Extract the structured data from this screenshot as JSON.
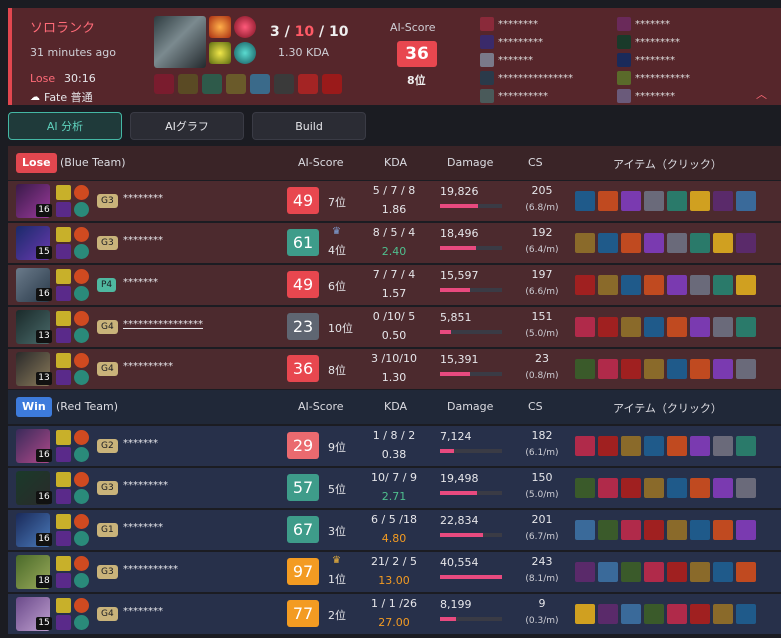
{
  "summary": {
    "queue": "ソロランク",
    "time_ago": "31 minutes ago",
    "result": "Lose",
    "duration": "30:16",
    "mode": "Fate 普通",
    "kda_kills": "3",
    "kda_deaths": "10",
    "kda_assists": "10",
    "kda_ratio": "1.30 KDA",
    "ai_score_label": "AI-Score",
    "ai_score": "36",
    "rank": "8位",
    "team_a": [
      "********",
      "*********",
      "*******",
      "***************",
      "**********"
    ],
    "team_b": [
      "*******",
      "*********",
      "********",
      "***********",
      "********"
    ]
  },
  "tabs": [
    "AI 分析",
    "AIグラフ",
    "Build"
  ],
  "headers": {
    "ai_score": "AI-Score",
    "kda": "KDA",
    "damage": "Damage",
    "cs": "CS",
    "items": "アイテム（クリック）"
  },
  "lose_team": {
    "badge": "Lose",
    "name": "(Blue Team)",
    "rows": [
      {
        "level": "16",
        "tier": "G3",
        "name": "********",
        "score": "49",
        "rank": "7位",
        "kda": "5 / 7 / 8",
        "ratio": "1.86",
        "damage": "19,826",
        "dmg_pct": 0.62,
        "cs": "205",
        "cspm": "(6.8/m)"
      },
      {
        "level": "15",
        "tier": "G3",
        "name": "********",
        "score": "61",
        "rank": "4位",
        "kda": "8 / 5 / 4",
        "ratio": "2.40",
        "damage": "18,496",
        "dmg_pct": 0.58,
        "cs": "192",
        "cspm": "(6.4/m)"
      },
      {
        "level": "16",
        "tier": "P4",
        "name": "*******",
        "score": "49",
        "rank": "6位",
        "kda": "7 / 7 / 4",
        "ratio": "1.57",
        "damage": "15,597",
        "dmg_pct": 0.48,
        "cs": "197",
        "cspm": "(6.6/m)"
      },
      {
        "level": "13",
        "tier": "G4",
        "name": "****************",
        "score": "23",
        "rank": "10位",
        "kda": "0 /10/ 5",
        "ratio": "0.50",
        "damage": "5,851",
        "dmg_pct": 0.18,
        "cs": "151",
        "cspm": "(5.0/m)"
      },
      {
        "level": "13",
        "tier": "G4",
        "name": "**********",
        "score": "36",
        "rank": "8位",
        "kda": "3 /10/10",
        "ratio": "1.30",
        "damage": "15,391",
        "dmg_pct": 0.48,
        "cs": "23",
        "cspm": "(0.8/m)"
      }
    ]
  },
  "win_team": {
    "badge": "Win",
    "name": "(Red Team)",
    "rows": [
      {
        "level": "16",
        "tier": "G2",
        "name": "*******",
        "score": "29",
        "rank": "9位",
        "kda": "1 / 8 / 2",
        "ratio": "0.38",
        "damage": "7,124",
        "dmg_pct": 0.22,
        "cs": "182",
        "cspm": "(6.1/m)"
      },
      {
        "level": "16",
        "tier": "G3",
        "name": "*********",
        "score": "57",
        "rank": "5位",
        "kda": "10/ 7 / 9",
        "ratio": "2.71",
        "damage": "19,498",
        "dmg_pct": 0.6,
        "cs": "150",
        "cspm": "(5.0/m)"
      },
      {
        "level": "16",
        "tier": "G1",
        "name": "********",
        "score": "67",
        "rank": "3位",
        "kda": "6 / 5 /18",
        "ratio": "4.80",
        "damage": "22,834",
        "dmg_pct": 0.7,
        "cs": "201",
        "cspm": "(6.7/m)"
      },
      {
        "level": "18",
        "tier": "G3",
        "name": "***********",
        "score": "97",
        "rank": "1位",
        "kda": "21/ 2 / 5",
        "ratio": "13.00",
        "damage": "40,554",
        "dmg_pct": 1.0,
        "cs": "243",
        "cspm": "(8.1/m)"
      },
      {
        "level": "15",
        "tier": "G4",
        "name": "********",
        "score": "77",
        "rank": "2位",
        "kda": "1 / 1 /26",
        "ratio": "27.00",
        "damage": "8,199",
        "dmg_pct": 0.25,
        "cs": "9",
        "cspm": "(0.3/m)"
      }
    ]
  }
}
